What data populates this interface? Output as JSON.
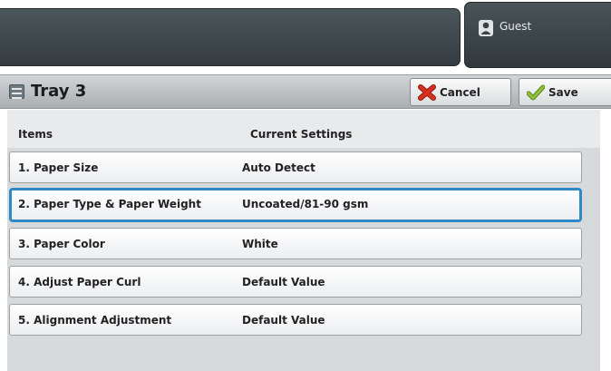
{
  "header": {
    "user_label": "Guest"
  },
  "title_bar": {
    "title": "Tray 3",
    "cancel_label": "Cancel",
    "save_label": "Save"
  },
  "table": {
    "columns": [
      "Items",
      "Current Settings"
    ],
    "rows": [
      {
        "item": "1. Paper Size",
        "value": "Auto Detect"
      },
      {
        "item": "2. Paper Type & Paper Weight",
        "value": "Uncoated/81-90 gsm"
      },
      {
        "item": "3. Paper Color",
        "value": "White"
      },
      {
        "item": "4. Adjust Paper Curl",
        "value": "Default Value"
      },
      {
        "item": "5. Alignment Adjustment",
        "value": "Default Value"
      }
    ]
  },
  "colors": {
    "selection_border": "#2f89c4",
    "cancel_icon": "#d8301f",
    "save_icon": "#8fc23a"
  }
}
